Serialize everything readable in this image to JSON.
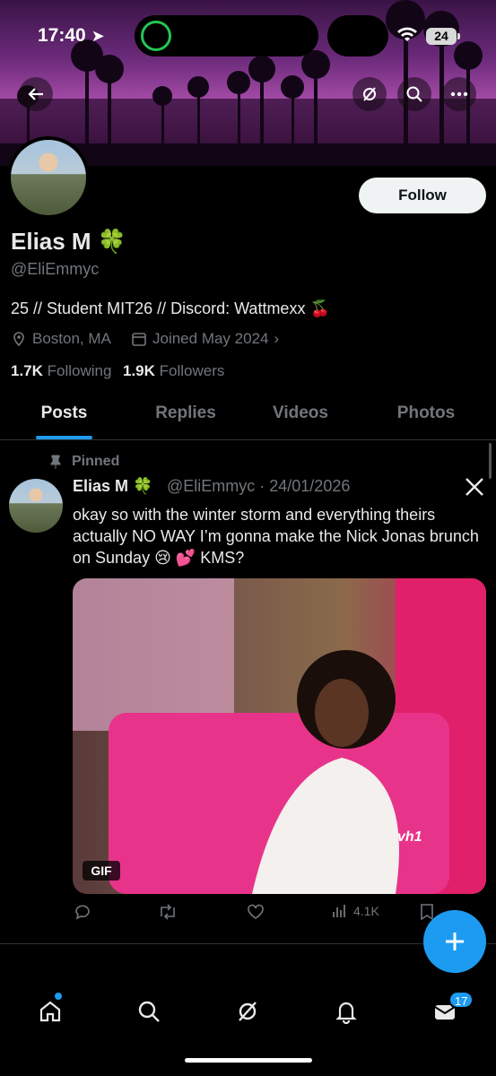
{
  "status_bar": {
    "time": "17:40",
    "battery": "24"
  },
  "profile": {
    "display_name": "Elias M",
    "name_emoji": "🍀",
    "handle": "@EliEmmyc",
    "bio": "25 // Student MIT26 // Discord: Wattmexx 🍒",
    "location": "Boston, MA",
    "joined": "Joined May 2024",
    "following_count": "1.7K",
    "following_label": "Following",
    "followers_count": "1.9K",
    "followers_label": "Followers",
    "follow_label": "Follow"
  },
  "tabs": [
    {
      "label": "Posts",
      "active": true
    },
    {
      "label": "Replies",
      "active": false
    },
    {
      "label": "Videos",
      "active": false
    },
    {
      "label": "Photos",
      "active": false
    }
  ],
  "post": {
    "pinned_label": "Pinned",
    "author_name": "Elias M",
    "author_emoji": "🍀",
    "author_handle": "@EliEmmyc · 24/01/2026",
    "text": "okay so with the winter storm and everything theirs actually NO WAY I’m gonna make the Nick Jonas brunch on Sunday 😢 💕 KMS?",
    "media_badge": "GIF",
    "views": "4.1K",
    "watermark": "vh1"
  },
  "bottom_nav": {
    "messages_badge": "17"
  },
  "colors": {
    "accent": "#1d9bf0",
    "background": "#000000",
    "muted": "#71767b"
  }
}
